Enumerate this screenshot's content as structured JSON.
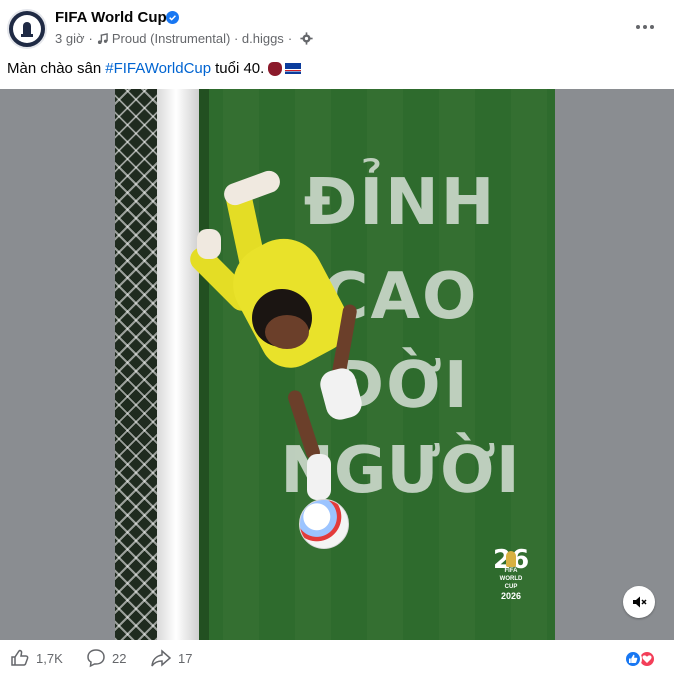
{
  "header": {
    "page_name": "FIFA World Cup",
    "time": "3 giờ",
    "audio": "Proud (Instrumental) · d.higgs"
  },
  "caption": {
    "before": "Màn chào sân",
    "hashtag": "#FIFAWorldCup",
    "after": "tuổi 40."
  },
  "media": {
    "headline": [
      "ĐỈNH",
      "CAO",
      "ĐỜI",
      "NGƯỜI"
    ],
    "logo": {
      "big": "26",
      "small": "FIFA",
      "caption": "WORLD CUP",
      "year": "2026"
    }
  },
  "footer": {
    "likes": "1,7K",
    "comments": "22",
    "shares": "17"
  },
  "colors": {
    "hashtag": "#0064d1",
    "like": "#1877f2",
    "love": "#f33e58"
  }
}
